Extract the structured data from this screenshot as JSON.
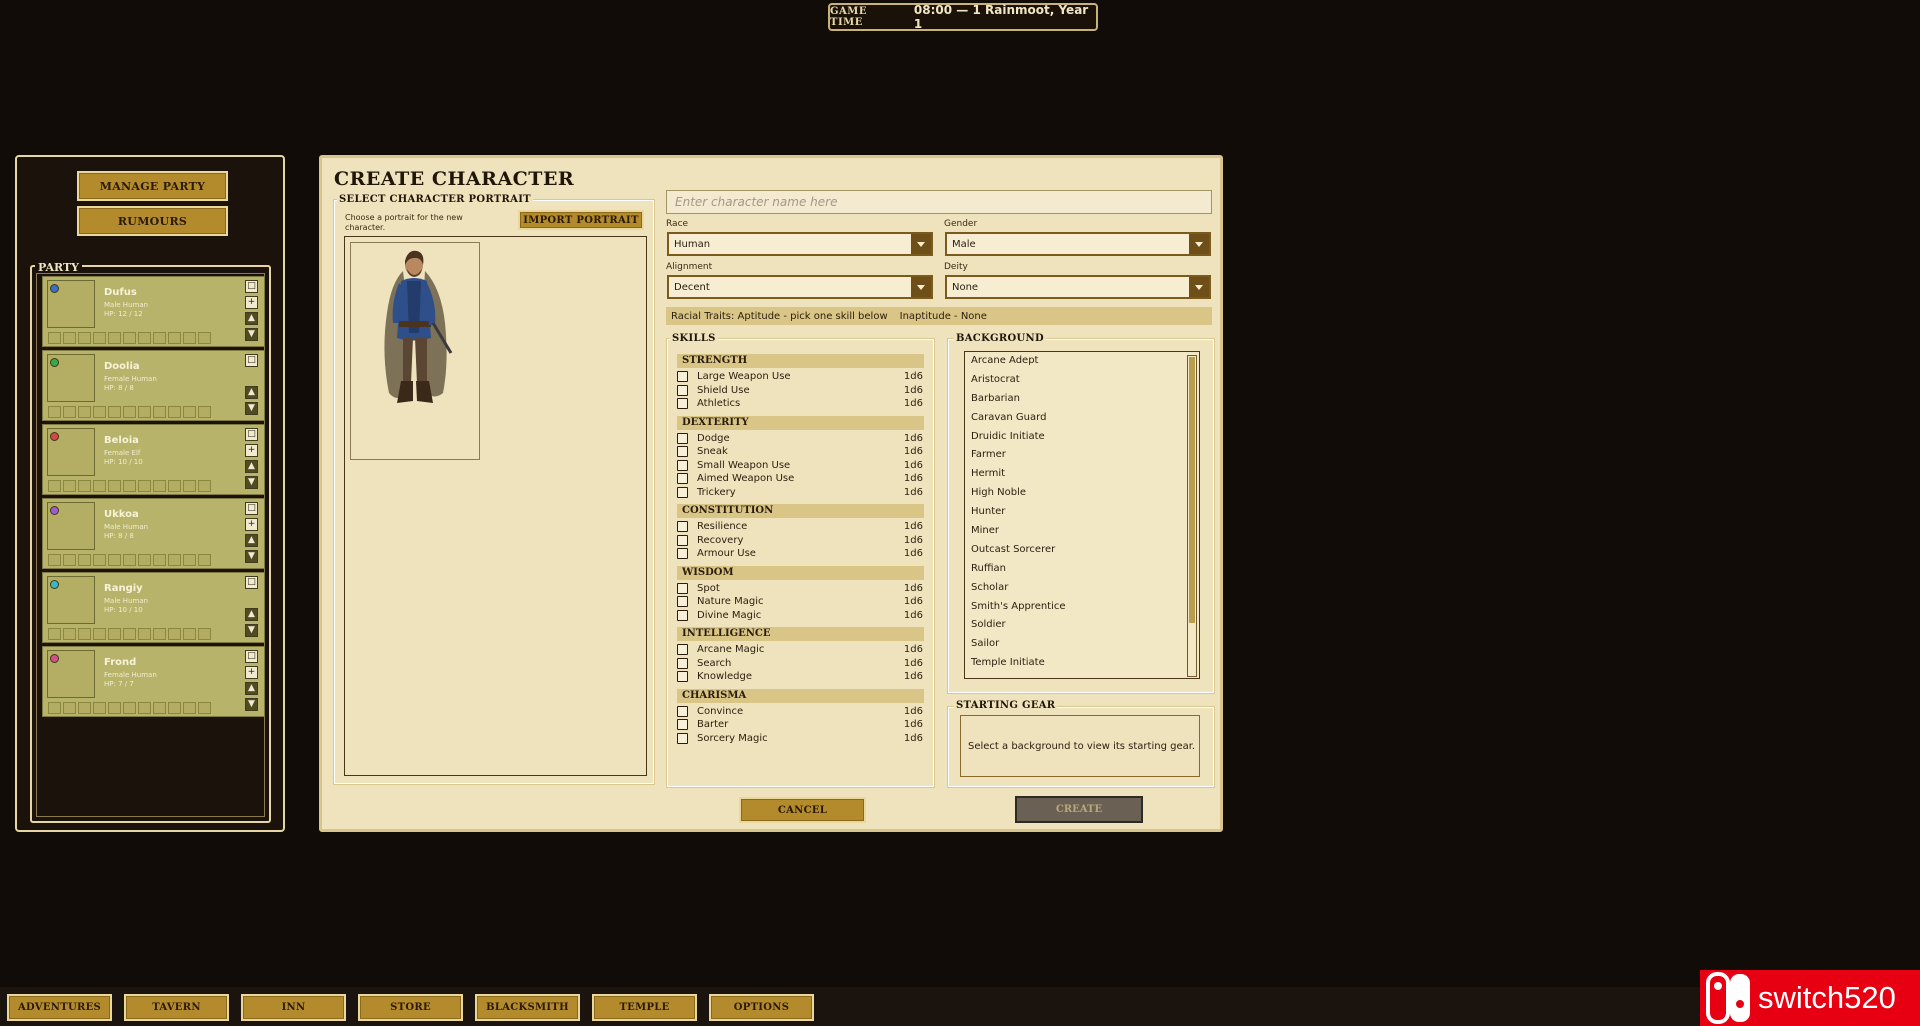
{
  "game_time": {
    "label": "GAME TIME",
    "value": "08:00 — 1 Rainmoot, Year 1"
  },
  "left_panel": {
    "manage_party": "MANAGE PARTY",
    "rumours": "RUMOURS",
    "party_title": "PARTY",
    "members": [
      {
        "name": "Dufus",
        "desc": "Male   Human",
        "hp": "HP:  12 / 12",
        "color": "#3a6ec8"
      },
      {
        "name": "Doolia",
        "desc": "Female   Human",
        "hp": "HP:  8 / 8",
        "color": "#3aa84a"
      },
      {
        "name": "Beloia",
        "desc": "Female   Elf",
        "hp": "HP:  10 / 10",
        "color": "#d04848"
      },
      {
        "name": "Ukkoa",
        "desc": "Male   Human",
        "hp": "HP:  8 / 8",
        "color": "#a05ad0"
      },
      {
        "name": "Rangiy",
        "desc": "Male   Human",
        "hp": "HP:  10 / 10",
        "color": "#3ab8c8"
      },
      {
        "name": "Frond",
        "desc": "Female   Human",
        "hp": "HP:  7 / 7",
        "color": "#d0508a"
      }
    ]
  },
  "create": {
    "title": "CREATE CHARACTER",
    "portrait_section": "SELECT CHARACTER PORTRAIT",
    "portrait_hint": "Choose a portrait for the new character.",
    "import_portrait": "IMPORT PORTRAIT",
    "name_placeholder": "Enter character name here",
    "race_label": "Race",
    "race_value": "Human",
    "gender_label": "Gender",
    "gender_value": "Male",
    "alignment_label": "Alignment",
    "alignment_value": "Decent",
    "deity_label": "Deity",
    "deity_value": "None",
    "racial_traits": "Racial Traits: Aptitude - pick one skill below",
    "inaptitude": "Inaptitude - None",
    "skills_title": "SKILLS",
    "skill_groups": [
      {
        "name": "STRENGTH",
        "skills": [
          {
            "name": "Large Weapon Use",
            "die": "1d6"
          },
          {
            "name": "Shield Use",
            "die": "1d6"
          },
          {
            "name": "Athletics",
            "die": "1d6"
          }
        ]
      },
      {
        "name": "DEXTERITY",
        "skills": [
          {
            "name": "Dodge",
            "die": "1d6"
          },
          {
            "name": "Sneak",
            "die": "1d6"
          },
          {
            "name": "Small Weapon Use",
            "die": "1d6"
          },
          {
            "name": "Aimed Weapon Use",
            "die": "1d6"
          },
          {
            "name": "Trickery",
            "die": "1d6"
          }
        ]
      },
      {
        "name": "CONSTITUTION",
        "skills": [
          {
            "name": "Resilience",
            "die": "1d6"
          },
          {
            "name": "Recovery",
            "die": "1d6"
          },
          {
            "name": "Armour Use",
            "die": "1d6"
          }
        ]
      },
      {
        "name": "WISDOM",
        "skills": [
          {
            "name": "Spot",
            "die": "1d6"
          },
          {
            "name": "Nature Magic",
            "die": "1d6"
          },
          {
            "name": "Divine Magic",
            "die": "1d6"
          }
        ]
      },
      {
        "name": "INTELLIGENCE",
        "skills": [
          {
            "name": "Arcane Magic",
            "die": "1d6"
          },
          {
            "name": "Search",
            "die": "1d6"
          },
          {
            "name": "Knowledge",
            "die": "1d6"
          }
        ]
      },
      {
        "name": "CHARISMA",
        "skills": [
          {
            "name": "Convince",
            "die": "1d6"
          },
          {
            "name": "Barter",
            "die": "1d6"
          },
          {
            "name": "Sorcery Magic",
            "die": "1d6"
          }
        ]
      }
    ],
    "background_title": "BACKGROUND",
    "backgrounds": [
      "Arcane Adept",
      "Aristocrat",
      "Barbarian",
      "Caravan Guard",
      "Druidic Initiate",
      "Farmer",
      "Hermit",
      "High Noble",
      "Hunter",
      "Miner",
      "Outcast Sorcerer",
      "Ruffian",
      "Scholar",
      "Smith's Apprentice",
      "Soldier",
      "Sailor",
      "Temple Initiate"
    ],
    "gear_title": "STARTING GEAR",
    "gear_text": "Select a background to view its starting gear.",
    "cancel": "CANCEL",
    "create": "CREATE"
  },
  "nav": [
    "ADVENTURES",
    "TAVERN",
    "INN",
    "STORE",
    "BLACKSMITH",
    "TEMPLE",
    "OPTIONS"
  ],
  "watermark": "switch520"
}
